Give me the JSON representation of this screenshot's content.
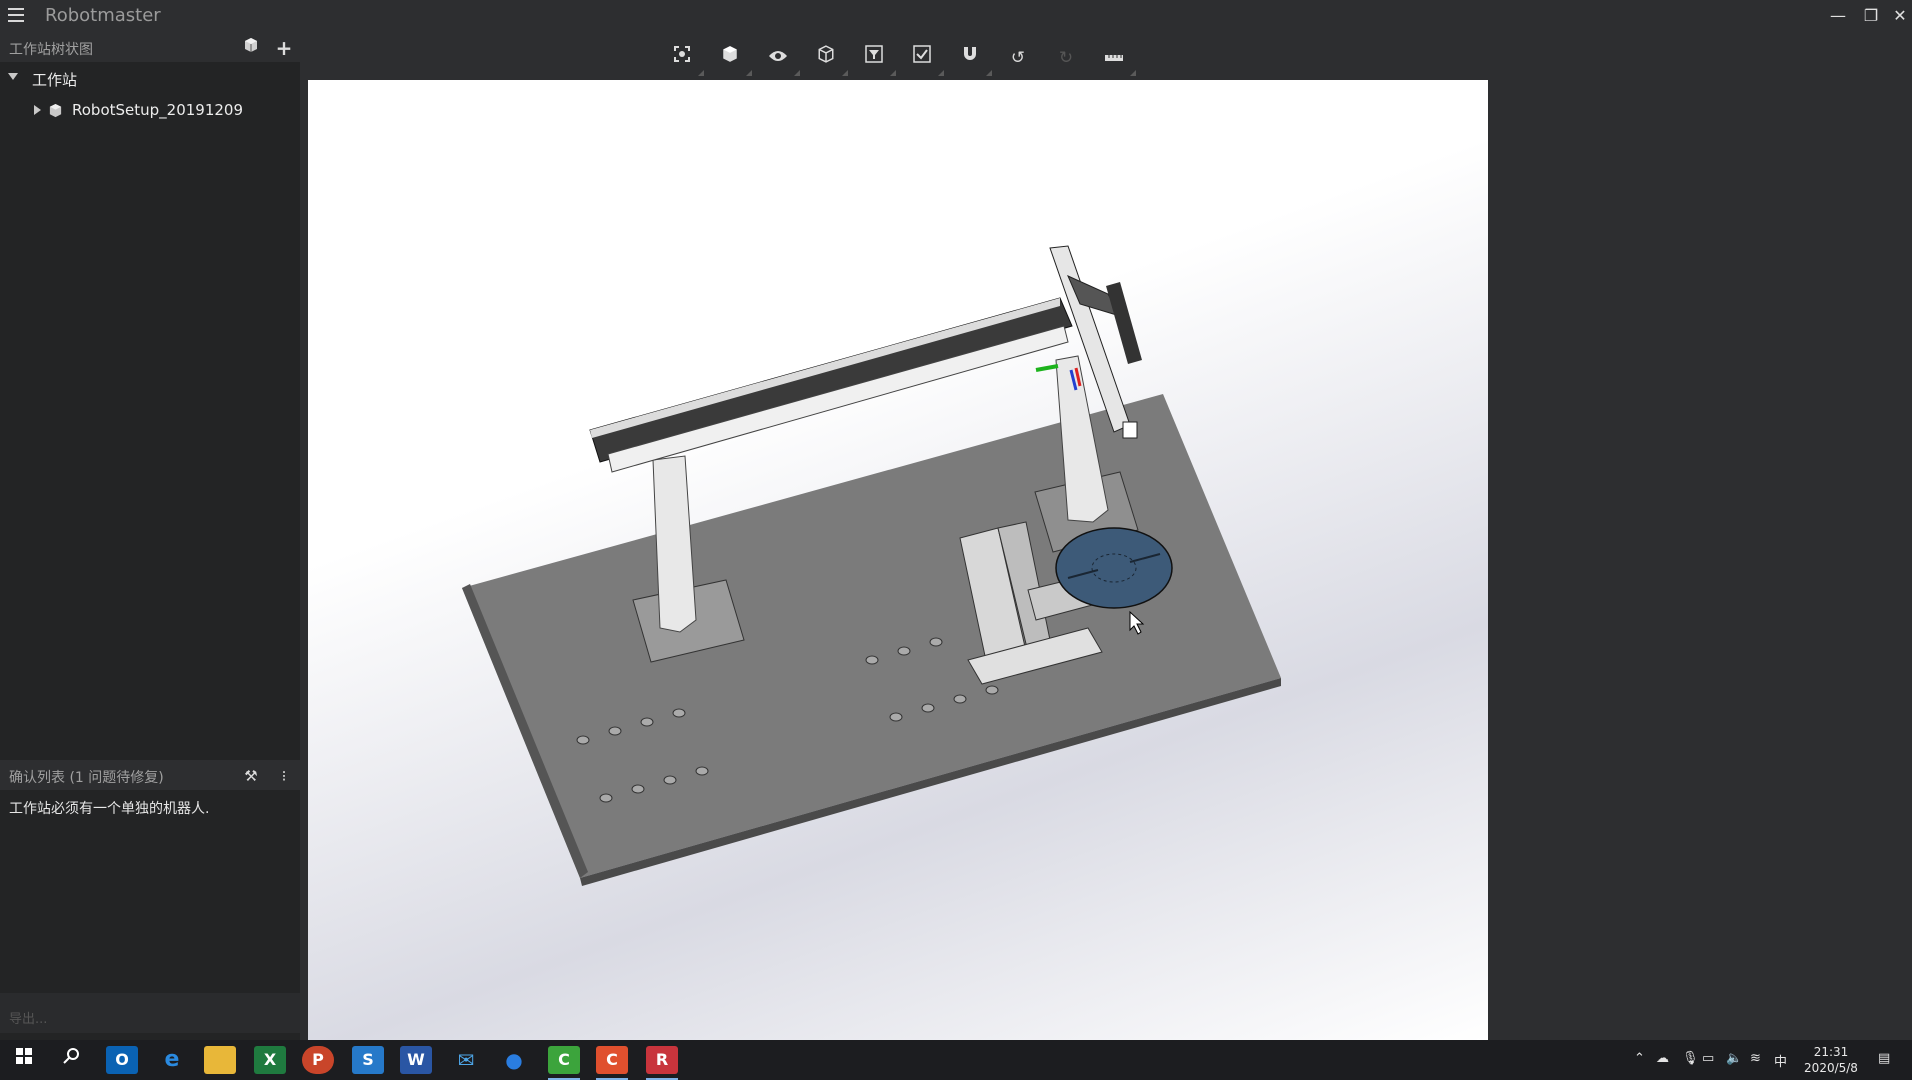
{
  "app": {
    "title": "Robotmaster"
  },
  "window_controls": {
    "minimize": "—",
    "restore": "❐",
    "close": "✕"
  },
  "tree_panel": {
    "title": "工作站树状图",
    "icons": [
      "cube-icon",
      "plus-icon"
    ],
    "items": [
      {
        "label": "工作站",
        "expanded": true
      },
      {
        "label": "RobotSetup_20191209",
        "expanded": false
      }
    ]
  },
  "toolbar": {
    "buttons": [
      "fit-view",
      "solid-cube",
      "visibility-eye",
      "wireframe-cube",
      "filter",
      "checklist",
      "magnet-snap",
      "undo",
      "redo",
      "ruler"
    ]
  },
  "issues_panel": {
    "title": "确认列表 (1 问题待修复)",
    "message": "工作站必须有一个单独的机器人."
  },
  "export": {
    "label": "导出..."
  },
  "taskbar": {
    "apps": [
      "windows-start",
      "search",
      "outlook",
      "edge",
      "file-explorer",
      "excel",
      "powerpoint",
      "s-app",
      "word",
      "mail",
      "maps",
      "camtasia",
      "c-app",
      "robotmaster"
    ],
    "tray": {
      "ime": "中"
    },
    "clock": {
      "time": "21:31",
      "date": "2020/5/8"
    }
  },
  "colors": {
    "background": "#2d2e30",
    "panel": "#232425",
    "turntable": "#3d5a78",
    "taskbar": "#1c1d20"
  }
}
